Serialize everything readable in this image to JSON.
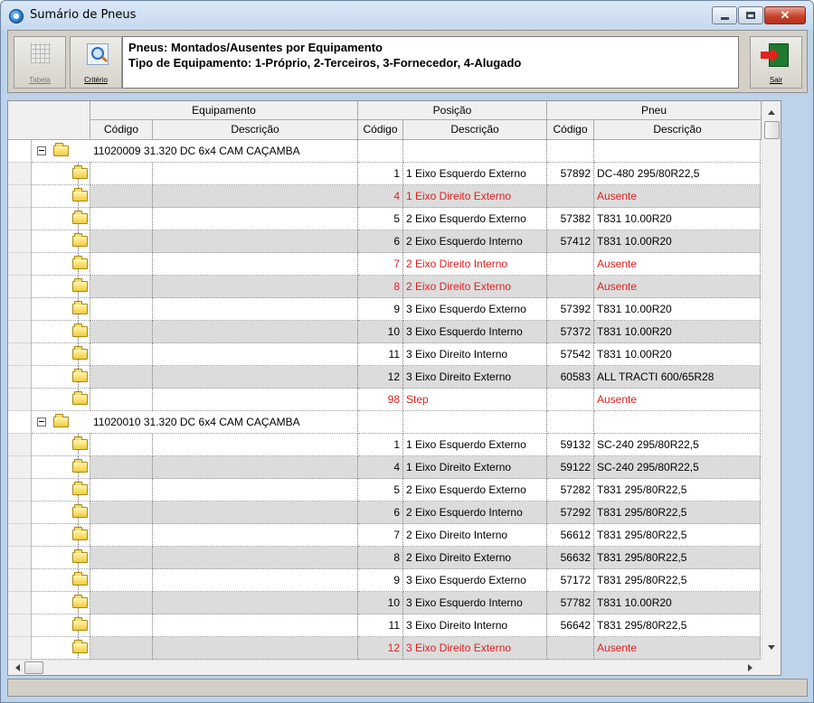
{
  "window": {
    "title": "Sumário de Pneus"
  },
  "toolbar": {
    "tabela_label": "Tabela",
    "criterio_label": "Critério",
    "sair_label": "Sair",
    "info_line1": "Pneus: Montados/Ausentes por Equipamento",
    "info_line2": "Tipo de Equipamento: 1-Próprio, 2-Terceiros, 3-Fornecedor, 4-Alugado"
  },
  "grid": {
    "group_headers": {
      "equipamento": "Equipamento",
      "posicao": "Posição",
      "pneu": "Pneu"
    },
    "column_headers": {
      "equip_codigo": "Código",
      "equip_descricao": "Descrição",
      "pos_codigo": "Código",
      "pos_descricao": "Descrição",
      "pneu_codigo": "Código",
      "pneu_descricao": "Descrição"
    },
    "accent_missing_color": "#e02020",
    "rows": [
      {
        "kind": "group",
        "codigo": "11020009",
        "descricao": "31.320 DC 6x4 CAM CAÇAMBA"
      },
      {
        "kind": "item",
        "pos_codigo": "1",
        "pos_descricao": "1 Eixo Esquerdo Externo",
        "pneu_codigo": "57892",
        "pneu_descricao": "DC-480 295/80R22,5",
        "missing": false
      },
      {
        "kind": "item",
        "pos_codigo": "4",
        "pos_descricao": "1 Eixo Direito Externo",
        "pneu_codigo": "",
        "pneu_descricao": "Ausente",
        "missing": true
      },
      {
        "kind": "item",
        "pos_codigo": "5",
        "pos_descricao": "2 Eixo Esquerdo Externo",
        "pneu_codigo": "57382",
        "pneu_descricao": "T831 10.00R20",
        "missing": false
      },
      {
        "kind": "item",
        "pos_codigo": "6",
        "pos_descricao": "2 Eixo Esquerdo Interno",
        "pneu_codigo": "57412",
        "pneu_descricao": "T831 10.00R20",
        "missing": false
      },
      {
        "kind": "item",
        "pos_codigo": "7",
        "pos_descricao": "2 Eixo Direito Interno",
        "pneu_codigo": "",
        "pneu_descricao": "Ausente",
        "missing": true
      },
      {
        "kind": "item",
        "pos_codigo": "8",
        "pos_descricao": "2 Eixo Direito Externo",
        "pneu_codigo": "",
        "pneu_descricao": "Ausente",
        "missing": true
      },
      {
        "kind": "item",
        "pos_codigo": "9",
        "pos_descricao": "3 Eixo Esquerdo Externo",
        "pneu_codigo": "57392",
        "pneu_descricao": "T831 10.00R20",
        "missing": false
      },
      {
        "kind": "item",
        "pos_codigo": "10",
        "pos_descricao": "3 Eixo Esquerdo Interno",
        "pneu_codigo": "57372",
        "pneu_descricao": "T831 10.00R20",
        "missing": false
      },
      {
        "kind": "item",
        "pos_codigo": "11",
        "pos_descricao": "3 Eixo Direito Interno",
        "pneu_codigo": "57542",
        "pneu_descricao": "T831 10.00R20",
        "missing": false
      },
      {
        "kind": "item",
        "pos_codigo": "12",
        "pos_descricao": "3 Eixo Direito Externo",
        "pneu_codigo": "60583",
        "pneu_descricao": "ALL TRACTI 600/65R28",
        "missing": false
      },
      {
        "kind": "item",
        "pos_codigo": "98",
        "pos_descricao": "Step",
        "pneu_codigo": "",
        "pneu_descricao": "Ausente",
        "missing": true,
        "last": true
      },
      {
        "kind": "group",
        "codigo": "11020010",
        "descricao": "31.320 DC 6x4 CAM CAÇAMBA"
      },
      {
        "kind": "item",
        "pos_codigo": "1",
        "pos_descricao": "1 Eixo Esquerdo Externo",
        "pneu_codigo": "59132",
        "pneu_descricao": "SC-240 295/80R22,5",
        "missing": false
      },
      {
        "kind": "item",
        "pos_codigo": "4",
        "pos_descricao": "1 Eixo Direito Externo",
        "pneu_codigo": "59122",
        "pneu_descricao": "SC-240 295/80R22,5",
        "missing": false
      },
      {
        "kind": "item",
        "pos_codigo": "5",
        "pos_descricao": "2 Eixo Esquerdo Externo",
        "pneu_codigo": "57282",
        "pneu_descricao": "T831 295/80R22,5",
        "missing": false
      },
      {
        "kind": "item",
        "pos_codigo": "6",
        "pos_descricao": "2 Eixo Esquerdo Interno",
        "pneu_codigo": "57292",
        "pneu_descricao": "T831 295/80R22,5",
        "missing": false
      },
      {
        "kind": "item",
        "pos_codigo": "7",
        "pos_descricao": "2 Eixo Direito Interno",
        "pneu_codigo": "56612",
        "pneu_descricao": "T831 295/80R22,5",
        "missing": false
      },
      {
        "kind": "item",
        "pos_codigo": "8",
        "pos_descricao": "2 Eixo Direito Externo",
        "pneu_codigo": "56632",
        "pneu_descricao": "T831 295/80R22,5",
        "missing": false
      },
      {
        "kind": "item",
        "pos_codigo": "9",
        "pos_descricao": "3 Eixo Esquerdo Externo",
        "pneu_codigo": "57172",
        "pneu_descricao": "T831 295/80R22,5",
        "missing": false
      },
      {
        "kind": "item",
        "pos_codigo": "10",
        "pos_descricao": "3 Eixo Esquerdo Interno",
        "pneu_codigo": "57782",
        "pneu_descricao": "T831 10.00R20",
        "missing": false
      },
      {
        "kind": "item",
        "pos_codigo": "11",
        "pos_descricao": "3 Eixo Direito Interno",
        "pneu_codigo": "56642",
        "pneu_descricao": "T831 295/80R22,5",
        "missing": false
      },
      {
        "kind": "item",
        "pos_codigo": "12",
        "pos_descricao": "3 Eixo Direito Externo",
        "pneu_codigo": "",
        "pneu_descricao": "Ausente",
        "missing": true
      }
    ]
  }
}
